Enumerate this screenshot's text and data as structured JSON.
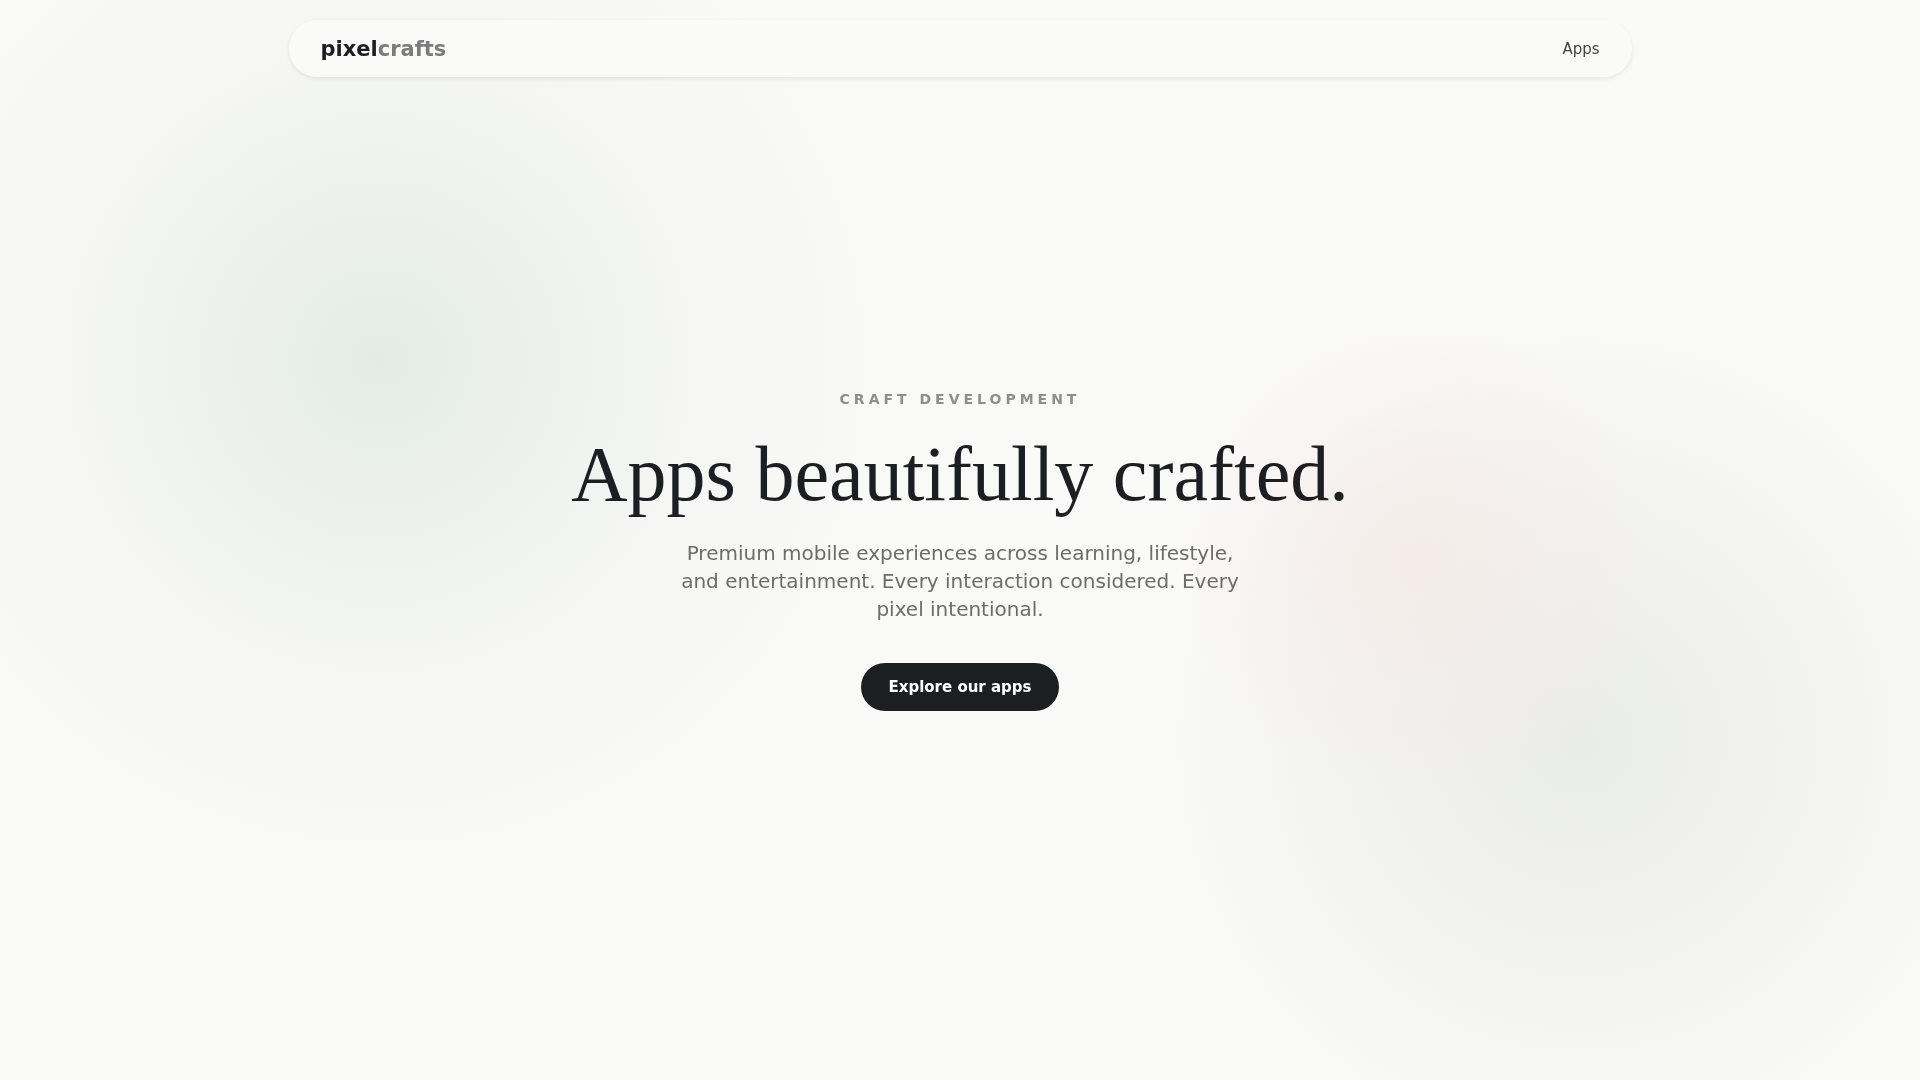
{
  "nav": {
    "logo": {
      "primary": "pixel",
      "secondary": "crafts"
    },
    "links": [
      "Apps"
    ]
  },
  "hero": {
    "eyebrow": "CRAFT DEVELOPMENT",
    "title": "Apps beautifully crafted.",
    "subtitle": "Premium mobile experiences across learning, lifestyle, and entertainment. Every interaction considered. Every pixel intentional.",
    "button": "Explore our apps"
  }
}
